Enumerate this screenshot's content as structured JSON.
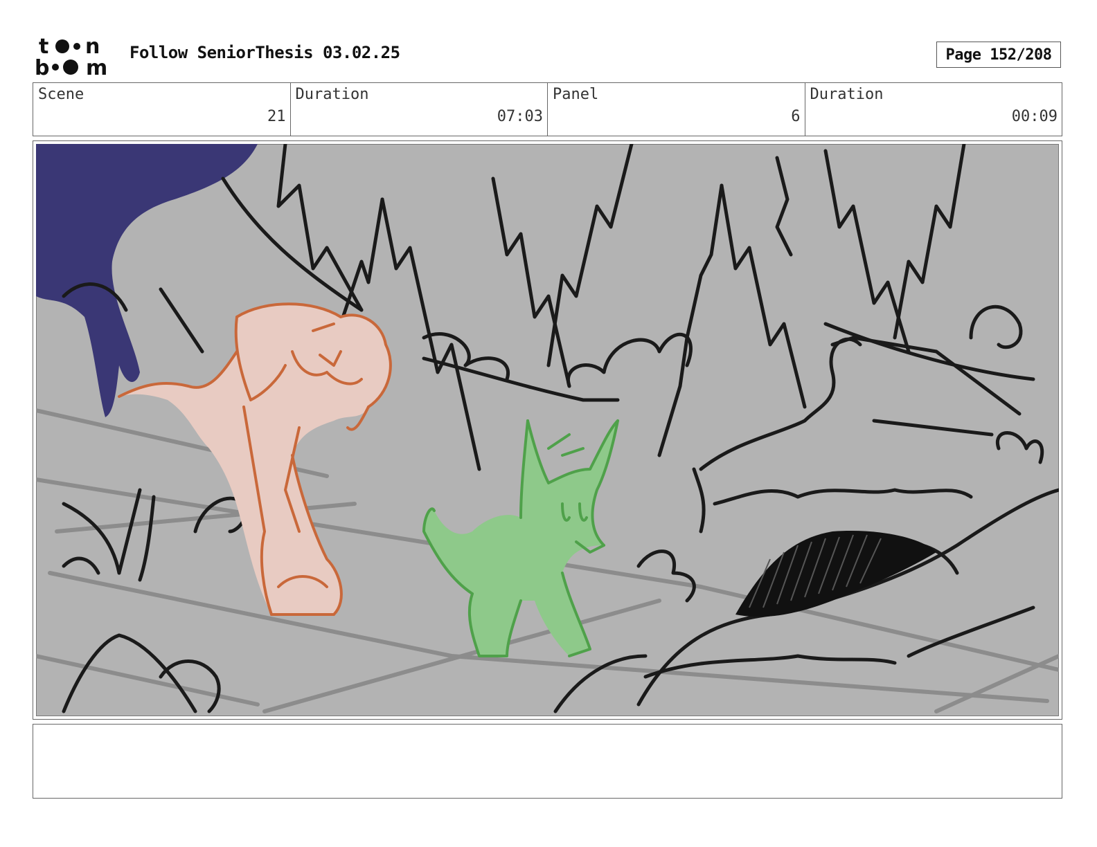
{
  "header": {
    "logo_top": "t  n",
    "logo_bottom": "b   m",
    "title": "Follow SeniorThesis 03.02.25",
    "page_label": "Page 152/208"
  },
  "info": {
    "scene_label": "Scene",
    "scene_value": "21",
    "scene_duration_label": "Duration",
    "scene_duration_value": "07:03",
    "panel_label": "Panel",
    "panel_value": "6",
    "panel_duration_label": "Duration",
    "panel_duration_value": "00:09"
  },
  "colors": {
    "background_gray": "#b3b3b3",
    "ink": "#1a1a1a",
    "dog_fill": "#e8cbc2",
    "dog_line": "#c9683a",
    "fox_fill": "#8ec98a",
    "fox_line": "#4fa14a",
    "shadow_purple": "#3a3775"
  },
  "panel": {
    "notes": ""
  }
}
